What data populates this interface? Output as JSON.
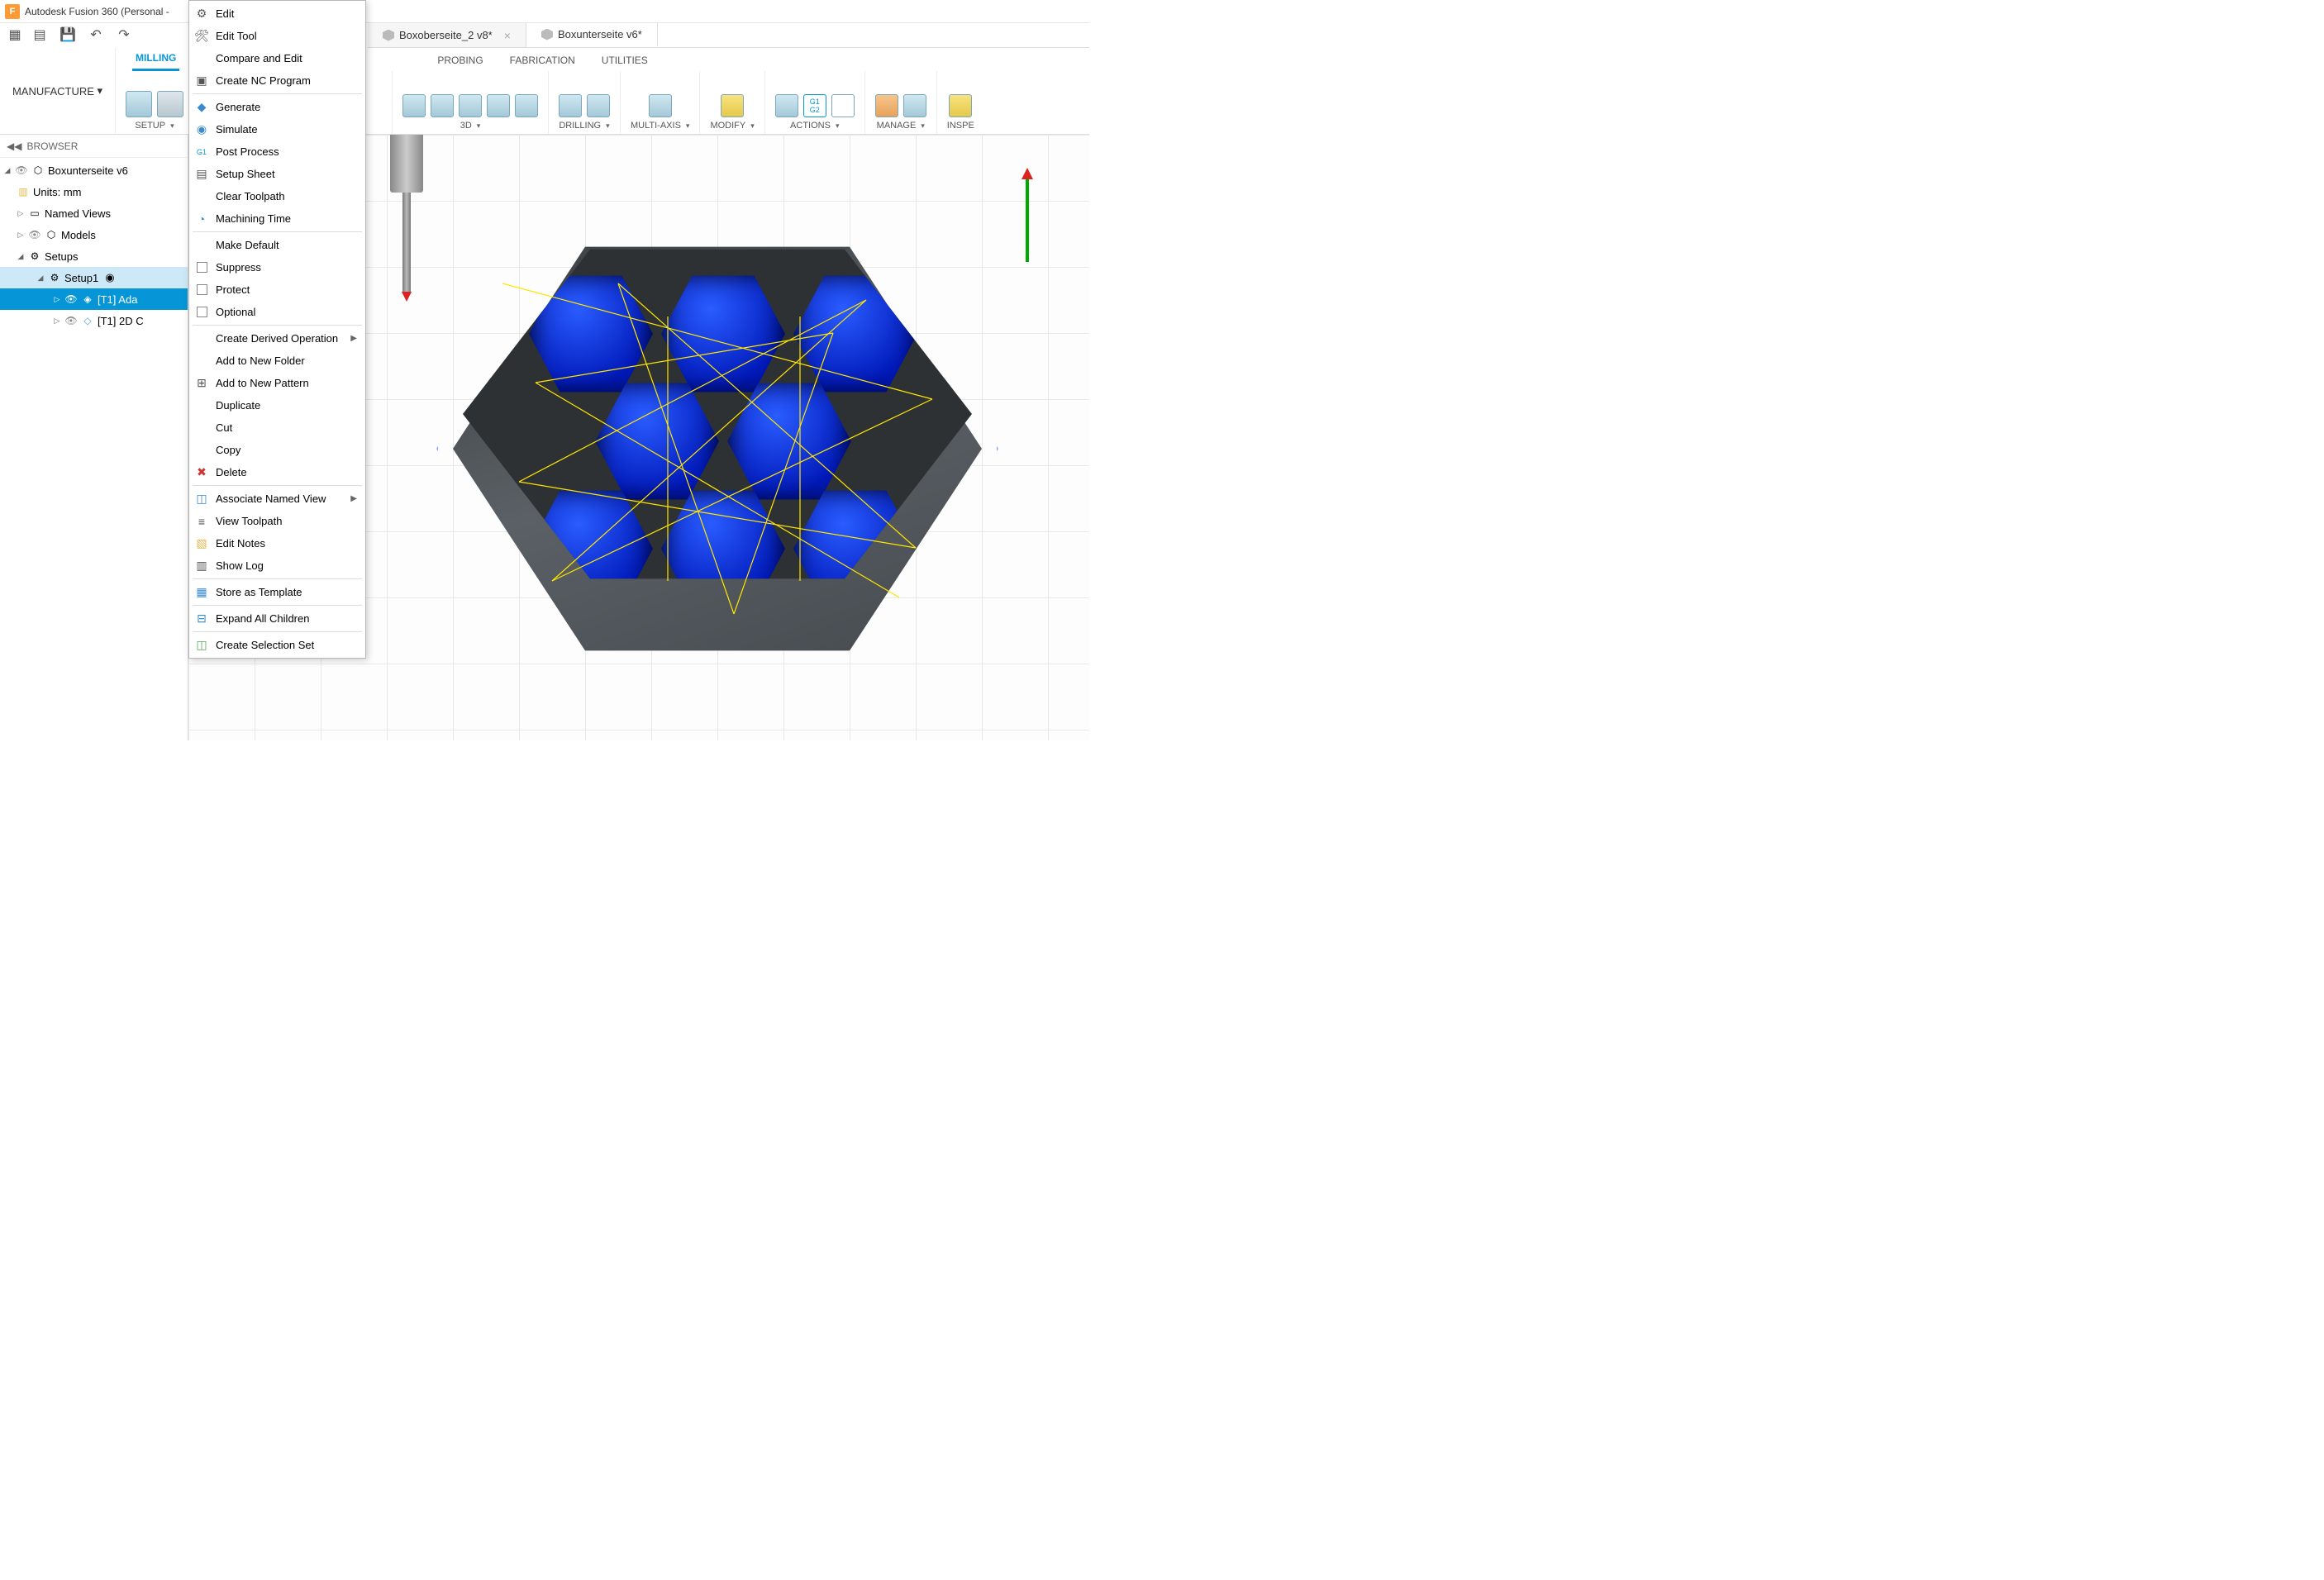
{
  "titlebar": {
    "app_name": "Autodesk Fusion 360 (Personal - "
  },
  "doctabs": [
    {
      "label": "Boxoberseite_2 v8*",
      "active": false
    },
    {
      "label": "Boxunterseite v6*",
      "active": true
    }
  ],
  "workspace": {
    "label": "MANUFACTURE"
  },
  "subtabs": {
    "milling": "MILLING",
    "probing": "PROBING",
    "fabrication": "FABRICATION",
    "utilities": "UTILITIES"
  },
  "ribbon_groups": {
    "setup": "SETUP",
    "three_d": "3D",
    "drilling": "DRILLING",
    "multi_axis": "MULTI-AXIS",
    "modify": "MODIFY",
    "actions": "ACTIONS",
    "manage": "MANAGE",
    "inspect": "INSPE"
  },
  "browser": {
    "title": "BROWSER",
    "root": "Boxunterseite v6",
    "units": "Units: mm",
    "named_views": "Named Views",
    "models": "Models",
    "setups": "Setups",
    "setup1": "Setup1",
    "op1": "[T1] Ada",
    "op2": "[T1] 2D C"
  },
  "context_menu": {
    "edit": "Edit",
    "edit_tool": "Edit Tool",
    "compare_edit": "Compare and Edit",
    "create_nc": "Create NC Program",
    "generate": "Generate",
    "simulate": "Simulate",
    "post_process": "Post Process",
    "setup_sheet": "Setup Sheet",
    "clear_toolpath": "Clear Toolpath",
    "machining_time": "Machining Time",
    "make_default": "Make Default",
    "suppress": "Suppress",
    "protect": "Protect",
    "optional": "Optional",
    "create_derived": "Create Derived Operation",
    "add_folder": "Add to New Folder",
    "add_pattern": "Add to New Pattern",
    "duplicate": "Duplicate",
    "cut": "Cut",
    "copy": "Copy",
    "delete": "Delete",
    "assoc_view": "Associate Named View",
    "view_toolpath": "View Toolpath",
    "edit_notes": "Edit Notes",
    "show_log": "Show Log",
    "store_template": "Store as Template",
    "expand_children": "Expand All Children",
    "create_selset": "Create Selection Set"
  }
}
